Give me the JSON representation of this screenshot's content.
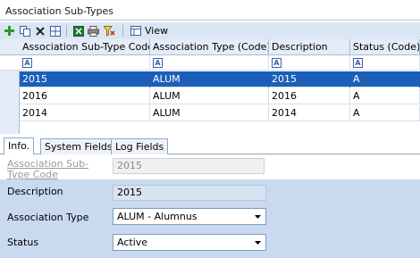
{
  "window": {
    "title": "Association Sub-Types"
  },
  "toolbar": {
    "buttons": [
      {
        "name": "add-icon",
        "color": "#2e9a2e"
      },
      {
        "name": "copy-icon",
        "color": "#3a5fa8"
      },
      {
        "name": "delete-icon",
        "color": "#222222"
      },
      {
        "name": "grid-columns-icon",
        "color": "#3a5fa8"
      },
      {
        "name": "excel-export-icon",
        "color": "#1e7a33"
      },
      {
        "name": "print-icon",
        "color": "#555555"
      },
      {
        "name": "filter-clear-icon",
        "color": "#c23b22"
      }
    ],
    "view_label": "View"
  },
  "grid": {
    "columns": [
      {
        "label": "Association Sub-Type Code"
      },
      {
        "label": "Association Type (Code)"
      },
      {
        "label": "Description"
      },
      {
        "label": "Status (Code)"
      }
    ],
    "rows": [
      {
        "code": "2015",
        "type": "ALUM",
        "description": "2015",
        "status": "A",
        "selected": true
      },
      {
        "code": "2016",
        "type": "ALUM",
        "description": "2016",
        "status": "A",
        "selected": false
      },
      {
        "code": "2014",
        "type": "ALUM",
        "description": "2014",
        "status": "A",
        "selected": false
      }
    ]
  },
  "tabs": [
    {
      "label": "Info.",
      "active": true
    },
    {
      "label": "System Fields",
      "active": false
    },
    {
      "label": "Log Fields",
      "active": false
    }
  ],
  "form": {
    "code_label": "Association Sub-Type Code",
    "code_value": "2015",
    "description_label": "Description",
    "description_value": "2015",
    "assoc_type_label": "Association Type",
    "assoc_type_value": "ALUM - Alumnus",
    "status_label": "Status",
    "status_value": "Active"
  },
  "colors": {
    "selected_row": "#1c5fb8",
    "form_background": "#c9d9ef",
    "toolbar_background": "#dbe6f4"
  }
}
